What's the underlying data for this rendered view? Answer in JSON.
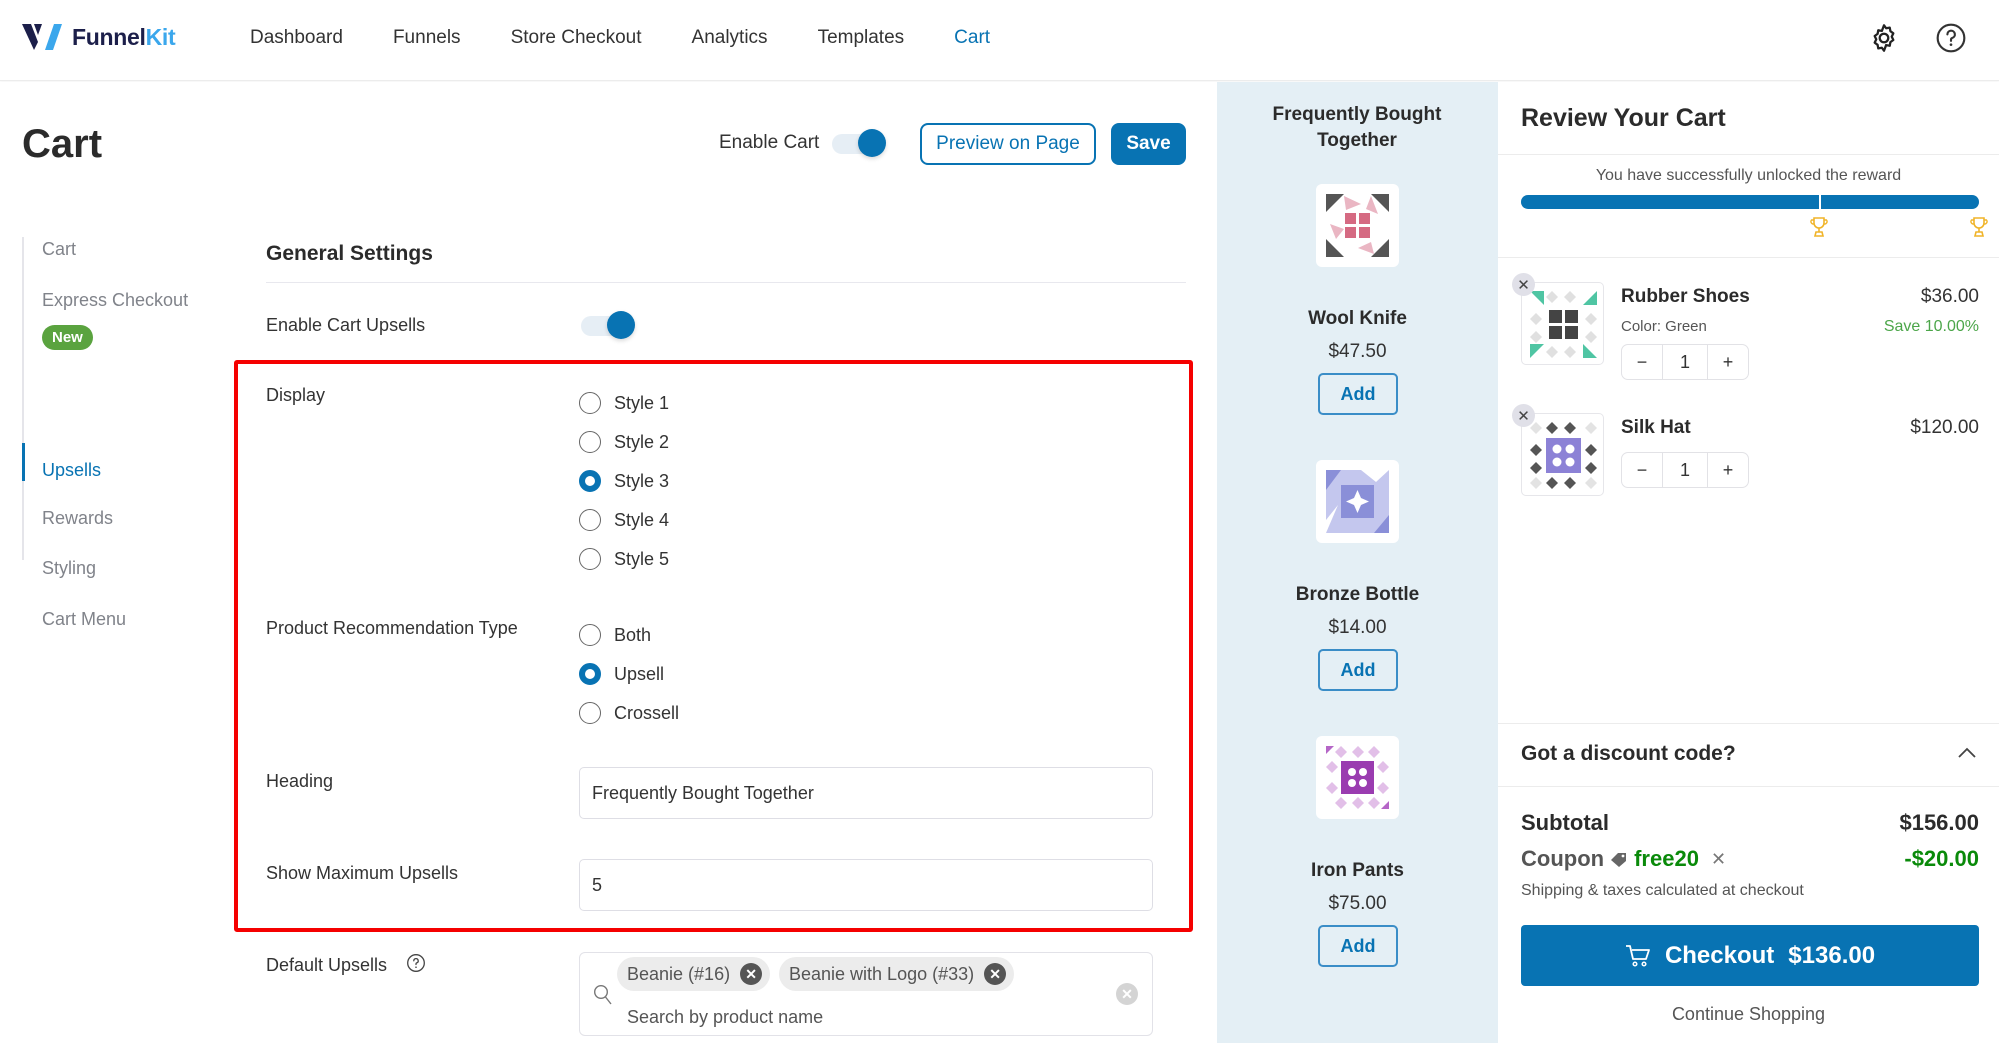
{
  "brand": {
    "name_part1": "Funnel",
    "name_part2": "Kit"
  },
  "nav": {
    "items": [
      {
        "label": "Dashboard",
        "active": false
      },
      {
        "label": "Funnels",
        "active": false
      },
      {
        "label": "Store Checkout",
        "active": false
      },
      {
        "label": "Analytics",
        "active": false
      },
      {
        "label": "Templates",
        "active": false
      },
      {
        "label": "Cart",
        "active": true
      }
    ],
    "icons": [
      "gear-icon",
      "help-icon"
    ]
  },
  "header": {
    "title": "Cart",
    "enable_cart_label": "Enable Cart",
    "enable_cart_on": true,
    "preview_label": "Preview on Page",
    "save_label": "Save"
  },
  "sidebar": {
    "items": [
      {
        "label": "Cart",
        "active": false
      },
      {
        "label": "Express Checkout",
        "active": false,
        "badge": "New"
      },
      {
        "label": "Upsells",
        "active": true
      },
      {
        "label": "Rewards",
        "active": false
      },
      {
        "label": "Styling",
        "active": false
      },
      {
        "label": "Cart Menu",
        "active": false
      }
    ]
  },
  "settings": {
    "section_title": "General Settings",
    "enable_upsells_label": "Enable Cart Upsells",
    "enable_upsells_on": true,
    "display": {
      "label": "Display",
      "options": [
        "Style 1",
        "Style 2",
        "Style 3",
        "Style 4",
        "Style 5"
      ],
      "selected": "Style 3"
    },
    "recommendation": {
      "label": "Product Recommendation Type",
      "options": [
        "Both",
        "Upsell",
        "Crossell"
      ],
      "selected": "Upsell"
    },
    "heading": {
      "label": "Heading",
      "value": "Frequently Bought Together"
    },
    "max_upsells": {
      "label": "Show Maximum Upsells",
      "value": "5"
    },
    "default_upsells": {
      "label": "Default Upsells",
      "chips": [
        "Beanie (#16)",
        "Beanie with Logo (#33)"
      ],
      "placeholder": "Search by product name"
    }
  },
  "fbt": {
    "title": "Frequently Bought Together",
    "add_label": "Add",
    "products": [
      {
        "name": "Wool Knife",
        "price": "$47.50"
      },
      {
        "name": "Bronze Bottle",
        "price": "$14.00"
      },
      {
        "name": "Iron Pants",
        "price": "$75.00"
      }
    ]
  },
  "cart": {
    "title": "Review Your Cart",
    "reward_text": "You have successfully unlocked the reward",
    "reward_progress_percent": 100,
    "reward_milestones_percent": [
      65,
      100
    ],
    "items": [
      {
        "name": "Rubber Shoes",
        "variant": "Color: Green",
        "price": "$36.00",
        "save": "Save 10.00%",
        "qty": "1"
      },
      {
        "name": "Silk Hat",
        "variant": "",
        "price": "$120.00",
        "save": "",
        "qty": "1"
      }
    ],
    "discount_label": "Got a discount code?",
    "subtotal_label": "Subtotal",
    "subtotal_value": "$156.00",
    "coupon_label": "Coupon",
    "coupon_code": "free20",
    "coupon_value": "-$20.00",
    "shipping_note": "Shipping & taxes calculated at checkout",
    "checkout_label": "Checkout",
    "checkout_total": "$136.00",
    "continue_label": "Continue Shopping"
  },
  "colors": {
    "accent": "#0873b3",
    "highlight_box": "#f50000",
    "success": "#0a8a0a",
    "badge_new": "#5aa33f"
  }
}
